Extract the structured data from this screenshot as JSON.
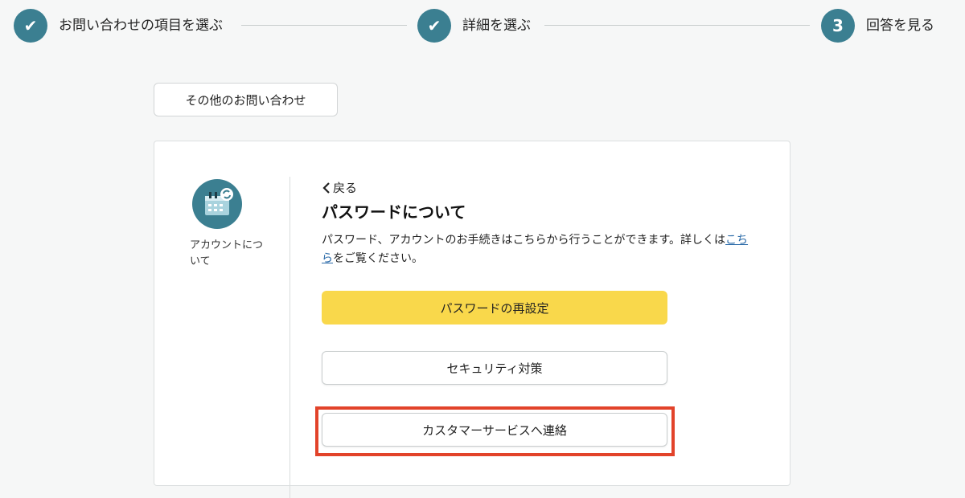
{
  "stepper": {
    "steps": [
      {
        "marker": "✔",
        "label": "お問い合わせの項目を選ぶ"
      },
      {
        "marker": "✔",
        "label": "詳細を選ぶ"
      },
      {
        "marker": "3",
        "label": "回答を見る"
      }
    ]
  },
  "other_inquiry_label": "その他のお問い合わせ",
  "category": {
    "label": "アカウントについて",
    "icon": "calendar-sync-icon"
  },
  "detail": {
    "back_label": "戻る",
    "title": "パスワードについて",
    "description_prefix": "パスワード、アカウントのお手続きはこちらから行うことができます。詳しくは",
    "description_link": "こちら",
    "description_suffix": "をご覧ください。"
  },
  "buttons": {
    "reset_password": "パスワードの再設定",
    "security": "セキュリティ対策",
    "contact_cs": "カスタマーサービスへ連絡"
  },
  "colors": {
    "accent": "#3b7f91",
    "primary_button": "#f9d84b",
    "highlight": "#e2432a"
  }
}
